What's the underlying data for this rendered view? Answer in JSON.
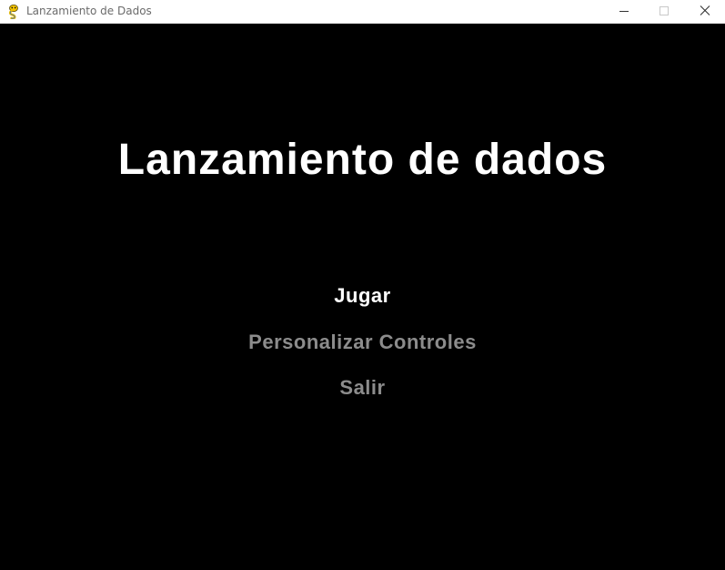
{
  "window": {
    "title": "Lanzamiento de Dados",
    "icon": "pygame-snake-icon",
    "controls": {
      "minimize_icon": "minimize-icon",
      "maximize_icon": "maximize-icon",
      "close_icon": "close-icon"
    }
  },
  "game": {
    "title": "Lanzamiento de dados",
    "background": "#000000",
    "menu": {
      "selected_color": "#ffffff",
      "idle_color": "#8c8c8c",
      "items": [
        {
          "label": "Jugar",
          "selected": true
        },
        {
          "label": "Personalizar Controles",
          "selected": false
        },
        {
          "label": "Salir",
          "selected": false
        }
      ]
    }
  }
}
